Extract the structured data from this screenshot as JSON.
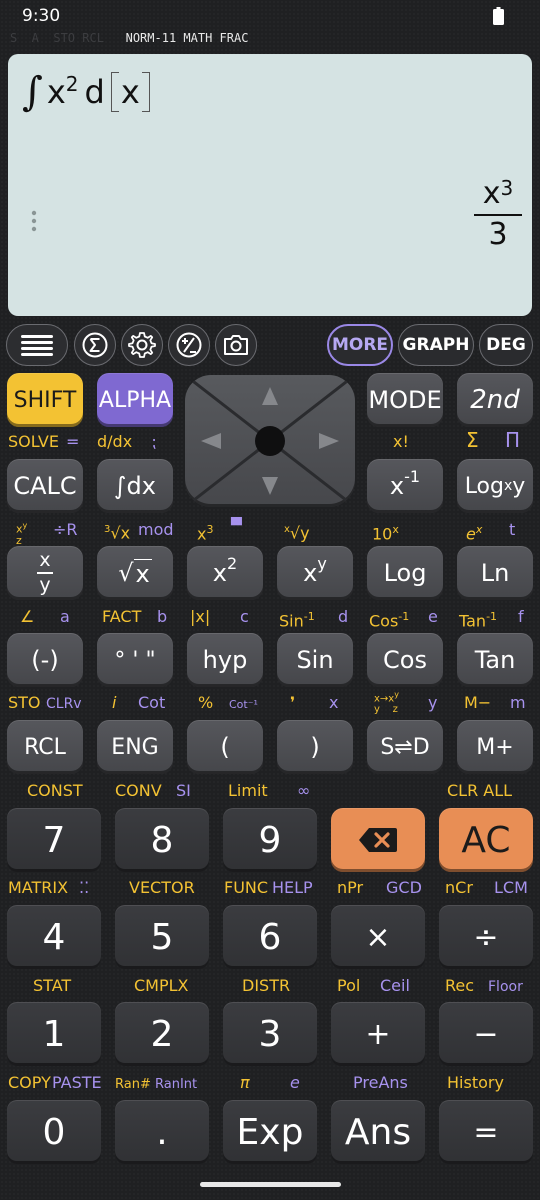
{
  "status": {
    "time": "9:30"
  },
  "indicators": {
    "dim": "S  A  STO RCL",
    "active": "NORM-11 MATH FRAC"
  },
  "display": {
    "expression": {
      "integral": "∫",
      "var": "x",
      "exp": "2",
      "d": "d",
      "arg": "x"
    },
    "result": {
      "num_base": "x",
      "num_exp": "3",
      "den": "3"
    }
  },
  "toolbar": {
    "more": "MORE",
    "graph": "GRAPH",
    "deg": "DEG"
  },
  "keys": {
    "shift": "SHIFT",
    "alpha": "ALPHA",
    "mode": "MODE",
    "second": "2nd",
    "calc": "CALC",
    "intdx": "∫dx",
    "x_inv_base": "x",
    "x_inv_exp": "-1",
    "log_base": "Log",
    "log_sub": "x",
    "log_y": "y",
    "frac_n": "x",
    "frac_d": "y",
    "sqrt": "x",
    "sq_base": "x",
    "sq_exp": "2",
    "pow_base": "x",
    "pow_exp": "y",
    "log": "Log",
    "ln": "Ln",
    "neg": "(-)",
    "deg_min_sec": "° ' \"",
    "hyp": "hyp",
    "sin": "Sin",
    "cos": "Cos",
    "tan": "Tan",
    "rcl": "RCL",
    "eng": "ENG",
    "lparen": "(",
    "rparen": ")",
    "sd": "S⇌D",
    "mplus": "M+",
    "d7": "7",
    "d8": "8",
    "d9": "9",
    "ac": "AC",
    "d4": "4",
    "d5": "5",
    "d6": "6",
    "mul": "×",
    "div": "÷",
    "d1": "1",
    "d2": "2",
    "d3": "3",
    "plus": "+",
    "minus": "−",
    "d0": "0",
    "dot": ".",
    "exp": "Exp",
    "ans": "Ans",
    "eq": "="
  },
  "labels": {
    "solve": "SOLVE",
    "solve_eq": "=",
    "ddx": "d/dx",
    "ddx_b": "⁏",
    "fact_x": "x!",
    "sum": "Σ",
    "prod": "Π",
    "r2_1": "÷R",
    "r2_2": "mod",
    "r2_3": "x",
    "r2_3e": "3",
    "r2_4": "▀",
    "r2_5": "10",
    "r2_5e": "x",
    "r2_6": "e",
    "r2_6e": "x",
    "r2_t": "t",
    "angle": "∠",
    "a": "a",
    "fact": "FACT",
    "b": "b",
    "abs": "|x|",
    "c": "c",
    "sin_inv": "Sin",
    "inv_exp": "-1",
    "d": "d",
    "cos_inv": "Cos",
    "e": "e",
    "tan_inv": "Tan",
    "f": "f",
    "sto": "STO",
    "clrv": "CLRv",
    "i": "i",
    "cot": "Cot",
    "pct": "%",
    "cot_inv": "Cot⁻¹",
    "comma": "❜",
    "x": "x",
    "y": "y",
    "mminus": "M−",
    "m": "m",
    "const": "CONST",
    "conv": "CONV",
    "si": "SI",
    "limit": "Limit",
    "inf": "∞",
    "clr_all": "CLR ALL",
    "matrix": "MATRIX",
    "matrix_dots": "⁚⁚",
    "vector": "VECTOR",
    "func": "FUNC",
    "help": "HELP",
    "npr": "nPr",
    "gcd": "GCD",
    "ncr": "nCr",
    "lcm": "LCM",
    "stat": "STAT",
    "cmplx": "CMPLX",
    "distr": "DISTR",
    "pol": "Pol",
    "ceil": "Ceil",
    "rec": "Rec",
    "floor": "Floor",
    "copy": "COPY",
    "paste": "PASTE",
    "ran": "Ran#",
    "ranint": "RanInt",
    "pi": "π",
    "econst": "e",
    "preans": "PreAns",
    "history": "History"
  },
  "colors": {
    "yellow": "#f3c233",
    "purple": "#a792ee",
    "orange": "#e88e55",
    "display": "#d5e3e3"
  }
}
